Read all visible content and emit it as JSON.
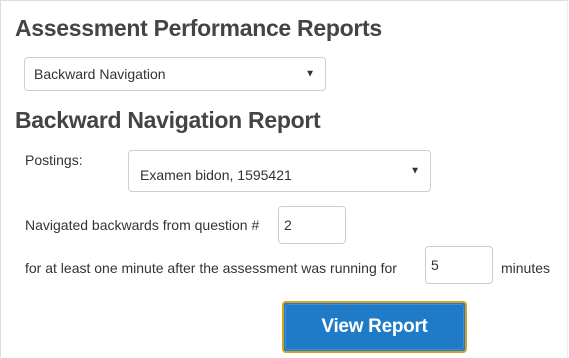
{
  "page": {
    "title": "Assessment Performance Reports"
  },
  "report_selector": {
    "selected": "Backward Navigation",
    "icon": "chevron-down-icon"
  },
  "report": {
    "title": "Backward Navigation Report",
    "postings_label": "Postings:",
    "postings_selected": "Examen bidon, 1595421",
    "backward_label": "Navigated backwards from question #",
    "question_value": "2",
    "running_label": "for at least one minute after the assessment was running for",
    "minutes_value": "5",
    "minutes_unit": "minutes"
  },
  "actions": {
    "view_report_label": "View Report",
    "button_color": "#1f7ac7",
    "button_border_color": "#d6a21e"
  }
}
